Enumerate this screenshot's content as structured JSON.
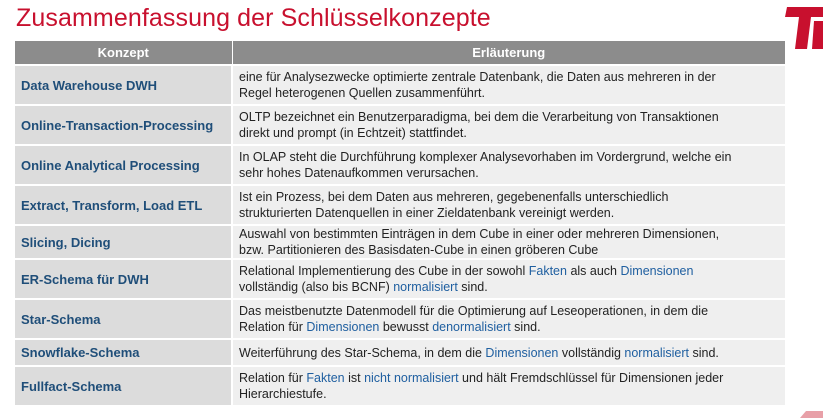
{
  "title": "Zusammenfassung der Schlüsselkonzepte",
  "logo": {
    "name": "university-logo",
    "color": "#c8102e"
  },
  "table": {
    "headers": [
      "Konzept",
      "Erläuterung"
    ],
    "rows": [
      {
        "concept": "Data Warehouse DWH",
        "lines": [
          [
            {
              "t": "eine für Analysezwecke optimierte zentrale Datenbank, die Daten aus mehreren in der"
            }
          ],
          [
            {
              "t": "Regel heterogenen Quellen zusammenführt."
            }
          ]
        ]
      },
      {
        "concept": "Online-Transaction-Processing",
        "lines": [
          [
            {
              "t": "OLTP bezeichnet ein Benutzerparadigma, bei dem die Verarbeitung von Transaktionen"
            }
          ],
          [
            {
              "t": "direkt und prompt (in Echtzeit) stattfindet."
            }
          ]
        ]
      },
      {
        "concept": "Online Analytical Processing",
        "lines": [
          [
            {
              "t": "In OLAP steht die Durchführung komplexer Analysevorhaben im Vordergrund, welche ein"
            }
          ],
          [
            {
              "t": "sehr hohes Datenaufkommen verursachen."
            }
          ]
        ]
      },
      {
        "concept": "Extract, Transform, Load ETL",
        "lines": [
          [
            {
              "t": "Ist ein Prozess, bei dem Daten aus mehreren, gegebenenfalls unterschiedlich"
            }
          ],
          [
            {
              "t": "strukturierten Datenquellen in einer Zieldatenbank vereinigt werden."
            }
          ]
        ]
      },
      {
        "concept": "Slicing, Dicing",
        "tight": true,
        "lines": [
          [
            {
              "t": "Auswahl von bestimmten Einträgen in dem Cube in einer oder mehreren Dimensionen,"
            }
          ],
          [
            {
              "t": "bzw.  Partitionieren des Basisdaten-Cube in einen gröberen Cube"
            }
          ]
        ]
      },
      {
        "concept": "ER-Schema für DWH",
        "lines": [
          [
            {
              "t": "Relational Implementierung des Cube in der sowohl "
            },
            {
              "t": "Fakten",
              "k": 1
            },
            {
              "t": " als auch "
            },
            {
              "t": "Dimensionen",
              "k": 1
            }
          ],
          [
            {
              "t": "vollständig (also bis BCNF) "
            },
            {
              "t": "normalisiert",
              "k": 1
            },
            {
              "t": " sind."
            }
          ]
        ]
      },
      {
        "concept": "Star-Schema",
        "lines": [
          [
            {
              "t": "Das meistbenutzte Datenmodell für die Optimierung auf Leseoperationen, in dem die"
            }
          ],
          [
            {
              "t": "Relation für "
            },
            {
              "t": "Dimensionen",
              "k": 1
            },
            {
              "t": " bewusst "
            },
            {
              "t": "denormalisiert",
              "k": 1
            },
            {
              "t": " sind."
            }
          ]
        ]
      },
      {
        "concept": "Snowflake-Schema",
        "lines": [
          [
            {
              "t": "Weiterführung des Star-Schema, in dem die "
            },
            {
              "t": "Dimensionen",
              "k": 1
            },
            {
              "t": " vollständig "
            },
            {
              "t": "normalisiert",
              "k": 1
            },
            {
              "t": " sind."
            }
          ]
        ]
      },
      {
        "concept": "Fullfact-Schema",
        "lines": [
          [
            {
              "t": "Relation für "
            },
            {
              "t": "Fakten",
              "k": 1
            },
            {
              "t": " ist "
            },
            {
              "t": "nicht normalisiert",
              "k": 1
            },
            {
              "t": " und hält Fremdschlüssel für Dimensionen jeder"
            }
          ],
          [
            {
              "t": "Hierarchiestufe."
            }
          ]
        ]
      }
    ],
    "row_heights": [
      40,
      40,
      40,
      40,
      33,
      40,
      40,
      27,
      40
    ],
    "colors": {
      "header_bg": "#8c8c8c",
      "concept_bg": "#dcdcdc",
      "explanation_bg": "#efefef",
      "concept_text": "#1f4e79",
      "keyword_text": "#1f5fa0",
      "title_text": "#c8102e"
    }
  }
}
